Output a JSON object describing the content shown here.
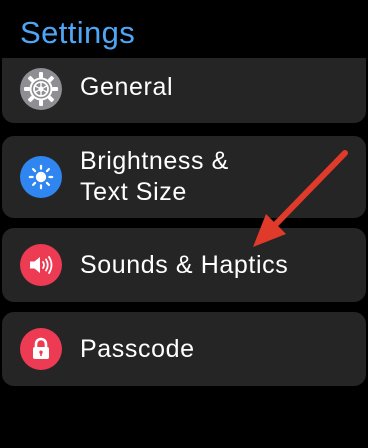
{
  "header": {
    "title": "Settings"
  },
  "items": [
    {
      "label": "General",
      "icon": "gear-icon",
      "icon_color": "#8E8E93"
    },
    {
      "label": "Brightness &\nText Size",
      "icon": "sun-icon",
      "icon_color": "#2F86F0"
    },
    {
      "label": "Sounds & Haptics",
      "icon": "speaker-icon",
      "icon_color": "#EC3B52"
    },
    {
      "label": "Passcode",
      "icon": "lock-icon",
      "icon_color": "#EC3B52"
    }
  ],
  "colors": {
    "title": "#4FA6F7",
    "row_background": "#252526",
    "annotation_arrow": "#E03A2A"
  }
}
